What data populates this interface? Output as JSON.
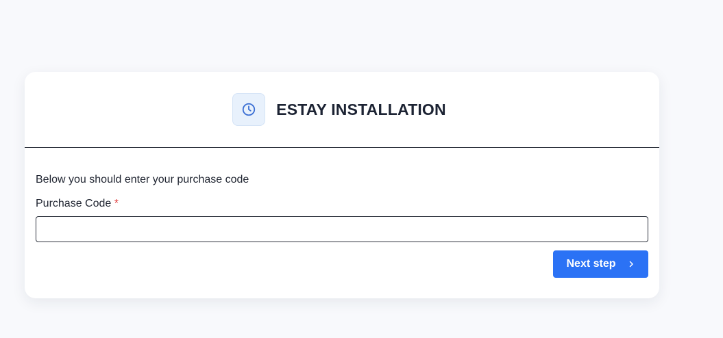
{
  "header": {
    "title": "ESTAY INSTALLATION",
    "icon": "clock-icon"
  },
  "form": {
    "intro": "Below you should enter your purchase code",
    "purchase_code_label": "Purchase Code",
    "required_marker": "*",
    "purchase_code_value": "",
    "next_label": "Next step",
    "next_icon": "chevron-right-icon"
  },
  "colors": {
    "accent": "#2b72f5",
    "required": "#e03b3b",
    "icon_bg": "#e8f1fc"
  }
}
